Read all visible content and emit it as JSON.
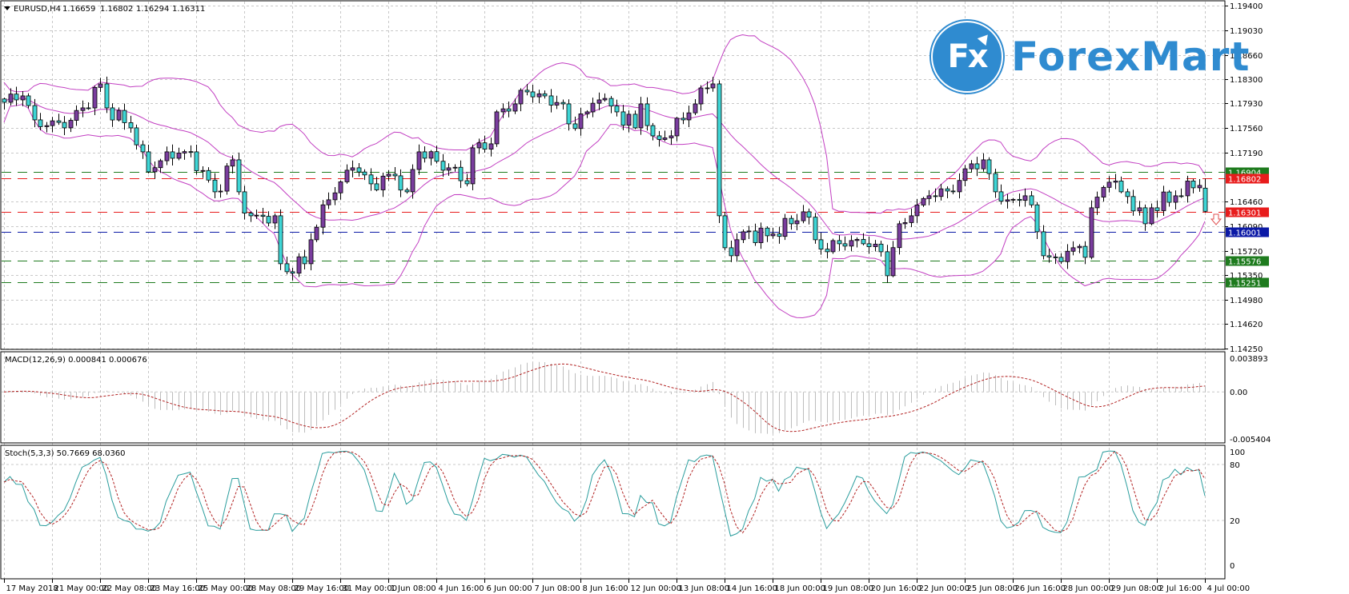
{
  "header": {
    "symbol": "EURUSD,H4",
    "open": "1.16659",
    "high": "1.16802",
    "low": "1.16294",
    "close": "1.16311"
  },
  "logo": {
    "mark": "Fx",
    "text": "ForexMart"
  },
  "macd_panel": {
    "label": "MACD(12,26,9) 0.000841 0.000676",
    "ticks": [
      "0.003893",
      "0.00",
      "-0.005404"
    ]
  },
  "stoch_panel": {
    "label": "Stoch(5,3,3) 50.7669 68.0360",
    "ticks": [
      "100",
      "80",
      "20",
      "0"
    ]
  },
  "colors": {
    "bull": "#7a3d9e",
    "bear": "#3fd6d6",
    "bands": "#c23fc2",
    "grid": "#c8c8c8",
    "macd_hist": "#bdbdbd",
    "signal": "#b22222",
    "stoch_main": "#2a9d9d",
    "level_green": "#1e7b1e",
    "level_red": "#e81c1c",
    "level_blue": "#0b19a6"
  },
  "chart_data": {
    "type": "candlestick",
    "title": "EURUSD,H4",
    "ylim": [
      1.1425,
      1.194
    ],
    "y_ticks": [
      "1.19400",
      "1.19030",
      "1.18660",
      "1.18300",
      "1.17930",
      "1.17560",
      "1.17190",
      "1.16460",
      "1.16090",
      "1.15720",
      "1.15350",
      "1.14980",
      "1.14620",
      "1.14250"
    ],
    "levels": [
      {
        "price": "1.16904",
        "color": "#1e7b1e"
      },
      {
        "price": "1.16802",
        "color": "#e81c1c"
      },
      {
        "price": "1.16301",
        "color": "#e81c1c"
      },
      {
        "price": "1.16001",
        "color": "#0b19a6"
      },
      {
        "price": "1.15576",
        "color": "#1e7b1e"
      },
      {
        "price": "1.15251",
        "color": "#1e7b1e"
      }
    ],
    "bar_count": 201,
    "bars_per_x_tick": 8,
    "x_ticks": [
      "17 May 2018",
      "21 May 00:00",
      "22 May 08:00",
      "23 May 16:00",
      "25 May 00:00",
      "28 May 08:00",
      "29 May 16:00",
      "31 May 00:00",
      "1 Jun 08:00",
      "4 Jun 16:00",
      "6 Jun 00:00",
      "7 Jun 08:00",
      "8 Jun 16:00",
      "12 Jun 00:00",
      "13 Jun 08:00",
      "14 Jun 16:00",
      "18 Jun 00:00",
      "19 Jun 08:00",
      "20 Jun 16:00",
      "22 Jun 00:00",
      "25 Jun 08:00",
      "26 Jun 16:00",
      "28 Jun 00:00",
      "29 Jun 08:00",
      "2 Jul 16:00",
      "4 Jul 00:00"
    ],
    "last_bar": {
      "open": 1.16659,
      "high": 1.16802,
      "low": 1.16294,
      "close": 1.16311
    },
    "close_path": [
      [
        0,
        1.17948
      ],
      [
        3,
        1.18044
      ],
      [
        5,
        1.17684
      ],
      [
        10,
        1.17564
      ],
      [
        13,
        1.17864
      ],
      [
        16,
        1.18224
      ],
      [
        17,
        1.17864
      ],
      [
        21,
        1.17564
      ],
      [
        23,
        1.17204
      ],
      [
        24,
        1.16904
      ],
      [
        27,
        1.17204
      ],
      [
        31,
        1.17204
      ],
      [
        35,
        1.16604
      ],
      [
        38,
        1.17084
      ],
      [
        39,
        1.16604
      ],
      [
        41,
        1.16244
      ],
      [
        45,
        1.16244
      ],
      [
        46,
        1.15524
      ],
      [
        47,
        1.15404
      ],
      [
        50,
        1.15524
      ],
      [
        51,
        1.15884
      ],
      [
        54,
        1.16484
      ],
      [
        58,
        1.16964
      ],
      [
        61,
        1.16724
      ],
      [
        65,
        1.16844
      ],
      [
        67,
        1.16604
      ],
      [
        69,
        1.17204
      ],
      [
        74,
        1.16964
      ],
      [
        77,
        1.16724
      ],
      [
        78,
        1.17264
      ],
      [
        81,
        1.17324
      ],
      [
        82,
        1.17804
      ],
      [
        85,
        1.17924
      ],
      [
        87,
        1.18104
      ],
      [
        90,
        1.18044
      ],
      [
        93,
        1.17924
      ],
      [
        94,
        1.17624
      ],
      [
        97,
        1.17804
      ],
      [
        99,
        1.17984
      ],
      [
        102,
        1.17804
      ],
      [
        105,
        1.17564
      ],
      [
        106,
        1.17924
      ],
      [
        108,
        1.17444
      ],
      [
        111,
        1.17444
      ],
      [
        113,
        1.17684
      ],
      [
        117,
        1.18164
      ],
      [
        118,
        1.18224
      ],
      [
        119,
        1.16244
      ],
      [
        120,
        1.15764
      ],
      [
        121,
        1.15644
      ],
      [
        123,
        1.16004
      ],
      [
        127,
        1.15944
      ],
      [
        131,
        1.16124
      ],
      [
        133,
        1.16304
      ],
      [
        135,
        1.15884
      ],
      [
        137,
        1.15704
      ],
      [
        139,
        1.15824
      ],
      [
        143,
        1.15824
      ],
      [
        146,
        1.15704
      ],
      [
        147,
        1.15344
      ],
      [
        149,
        1.16124
      ],
      [
        151,
        1.16244
      ],
      [
        154,
        1.16544
      ],
      [
        158,
        1.16604
      ],
      [
        161,
        1.17024
      ],
      [
        163,
        1.17084
      ],
      [
        165,
        1.16604
      ],
      [
        167,
        1.16484
      ],
      [
        170,
        1.16544
      ],
      [
        172,
        1.16004
      ],
      [
        173,
        1.15644
      ],
      [
        175,
        1.1562
      ],
      [
        178,
        1.15764
      ],
      [
        180,
        1.1562
      ],
      [
        181,
        1.16364
      ],
      [
        184,
        1.16748
      ],
      [
        186,
        1.16604
      ],
      [
        189,
        1.16364
      ],
      [
        190,
        1.16124
      ],
      [
        191,
        1.16364
      ],
      [
        195,
        1.16544
      ],
      [
        198,
        1.16664
      ],
      [
        199,
        1.167
      ],
      [
        200,
        1.16311
      ]
    ],
    "indicators": {
      "bollinger": {
        "period": 20,
        "deviation": 2
      },
      "macd": {
        "fast": 12,
        "slow": 26,
        "signal": 9,
        "ylim": [
          -0.005404,
          0.003893
        ]
      },
      "stochastic": {
        "k": 5,
        "d": 3,
        "slowing": 3,
        "ylim": [
          0,
          100
        ],
        "levels": [
          20,
          80
        ]
      }
    }
  }
}
